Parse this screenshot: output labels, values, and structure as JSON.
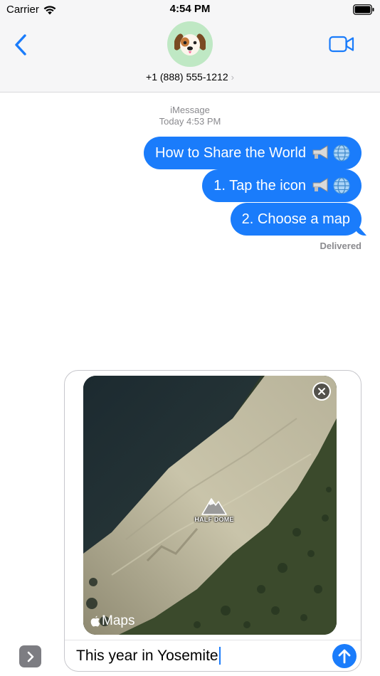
{
  "status_bar": {
    "carrier": "Carrier",
    "time": "4:54 PM"
  },
  "header": {
    "contact": "+1 (888) 555-1212",
    "contact_chevron": "›",
    "avatar_emoji": "🐶",
    "back_icon": "chevron-left-icon",
    "video_icon": "video-camera-icon"
  },
  "thread": {
    "service": "iMessage",
    "timestamp": "Today 4:53 PM",
    "messages": [
      {
        "text": "How to Share the World",
        "emoji": "📢🌐"
      },
      {
        "text": "1. Tap the icon",
        "emoji": "📢🌐"
      },
      {
        "text": "2. Choose a map",
        "emoji": ""
      }
    ],
    "status": "Delivered"
  },
  "compose": {
    "map_poi_label": "HALF DOME",
    "map_brand": "Maps",
    "text": "This year in Yosemite",
    "send_icon": "arrow-up-icon",
    "remove_icon": "close-icon",
    "apps_icon": "chevron-right-icon"
  },
  "colors": {
    "accent": "#1a7cfb",
    "header_bg": "#f6f6f7",
    "avatar_bg": "#bfe8c4",
    "meta_text": "#8a8a8e"
  }
}
